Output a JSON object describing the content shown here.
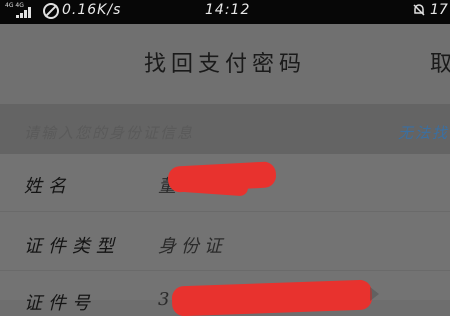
{
  "status_bar": {
    "network_type": "4G 4G",
    "speed": "0.16K/s",
    "time": "14:12",
    "battery_text": "17"
  },
  "nav": {
    "title": "找回支付密码",
    "cancel": "取"
  },
  "hint": {
    "text": "请输入您的身份证信息",
    "link": "无法找"
  },
  "form": {
    "name_label": "姓名",
    "name_value": "董",
    "id_type_label": "证件类型",
    "id_type_value": "身份证",
    "id_number_label": "证件号",
    "id_number_value": "3"
  },
  "colors": {
    "redaction": "#e8322e",
    "link": "#3b6fa0"
  }
}
